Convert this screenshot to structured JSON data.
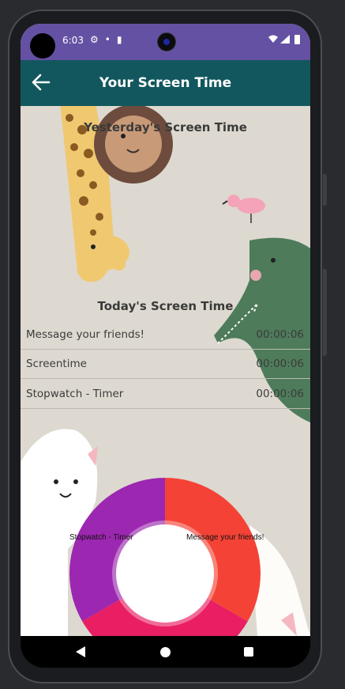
{
  "status_bar": {
    "time": "6:03",
    "left_icons": [
      "gear-icon",
      "notification-icon",
      "sd-card-icon"
    ],
    "right_icons": [
      "wifi-icon",
      "signal-icon",
      "battery-icon"
    ]
  },
  "app_bar": {
    "title": "Your Screen Time",
    "back_icon": "arrow-left-icon"
  },
  "yesterday": {
    "title": "Yesterday's Screen Time"
  },
  "today": {
    "title": "Today's Screen Time",
    "rows": [
      {
        "name": "Message your friends!",
        "time": "00:00:06"
      },
      {
        "name": "Screentime",
        "time": "00:00:06"
      },
      {
        "name": "Stopwatch - Timer",
        "time": "00:00:06"
      }
    ]
  },
  "chart_data": {
    "type": "pie",
    "categories": [
      "Message your friends!",
      "Screentime",
      "Stopwatch - Timer"
    ],
    "values": [
      1,
      1,
      1
    ],
    "colors": [
      "#f44336",
      "#e91e63",
      "#9c27b0"
    ],
    "hole": true
  },
  "nav_bar": {
    "icons": [
      "back-triangle-icon",
      "home-circle-icon",
      "recents-square-icon"
    ]
  }
}
